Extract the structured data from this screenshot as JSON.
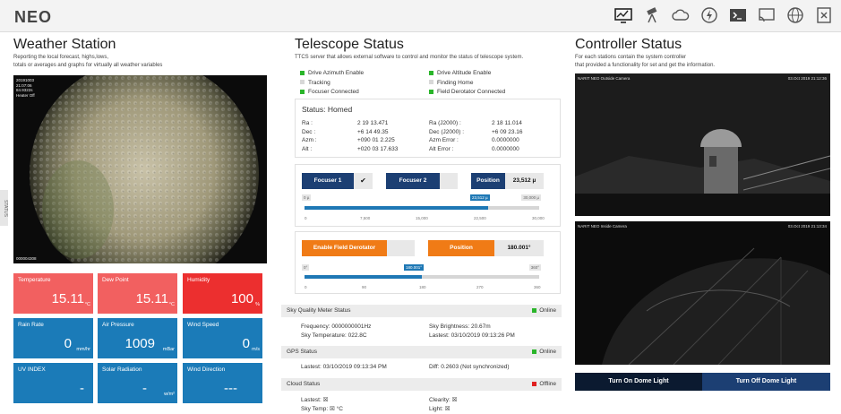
{
  "app": {
    "brand": "NEO",
    "top_icons": [
      "monitor-chart-icon",
      "telescope-icon",
      "cloud-icon",
      "lightning-icon",
      "terminal-icon",
      "cast-icon",
      "globe-icon",
      "exit-icon"
    ]
  },
  "weather": {
    "title": "Weather Station",
    "subtitle_line1": "Reporting the local forecast, highs,lows,",
    "subtitle_line2": "totals or averages and graphs for virtually all weather variables",
    "camera_overlay": [
      "20191003",
      "21:07:06",
      "84.9322s",
      "Heater Off"
    ],
    "camera_footer": "000004308",
    "status_tab": "STATUS",
    "tiles": [
      {
        "label": "Temperature",
        "value": "15.11",
        "unit": "°C",
        "color": "#f26060"
      },
      {
        "label": "Dew Point",
        "value": "15.11",
        "unit": "°C",
        "color": "#f26060"
      },
      {
        "label": "Humidity",
        "value": "100",
        "unit": "%",
        "color": "#ec2f2f"
      },
      {
        "label": "Rain Rate",
        "value": "0",
        "unit": "mm/hr",
        "color": "#1b7bb8"
      },
      {
        "label": "Air Pressure",
        "value": "1009",
        "unit": "mBar",
        "color": "#1b7bb8"
      },
      {
        "label": "Wind Speed",
        "value": "0",
        "unit": "m/s",
        "color": "#1b7bb8"
      },
      {
        "label": "UV INDEX",
        "value": "-",
        "unit": "",
        "color": "#1b7bb8"
      },
      {
        "label": "Solar Radiation",
        "value": "-",
        "unit": "w/m²",
        "color": "#1b7bb8"
      },
      {
        "label": "Wind Direction",
        "value": "---",
        "unit": "",
        "color": "#1b7bb8"
      }
    ]
  },
  "telescope": {
    "title": "Telescope Status",
    "subtitle": "TTCS server that allows external software to control and monitor the status of telescope system.",
    "checks_left": [
      {
        "label": "Drive Azimuth Enable",
        "on": true
      },
      {
        "label": "Tracking",
        "on": false
      },
      {
        "label": "Focuser Connected",
        "on": true
      }
    ],
    "checks_right": [
      {
        "label": "Drive Altitude Enable",
        "on": true
      },
      {
        "label": "Finding Home",
        "on": false
      },
      {
        "label": "Field Derotator Connected",
        "on": true
      }
    ],
    "status_label": "Status: Homed",
    "coords_left": [
      {
        "k": "Ra :",
        "v": "2 19 13.471"
      },
      {
        "k": "Dec :",
        "v": "+6 14 49.35"
      },
      {
        "k": "Azm :",
        "v": "+090 01 2.225"
      },
      {
        "k": "Alt :",
        "v": "+020 03 17.633"
      }
    ],
    "coords_right": [
      {
        "k": "Ra (J2000) :",
        "v": "2 18 11.014"
      },
      {
        "k": "Dec (J2000) :",
        "v": "+6 09 23.16"
      },
      {
        "k": "Azm Error :",
        "v": "0.0000000"
      },
      {
        "k": "Alt Error :",
        "v": "0.0000000"
      }
    ],
    "focuser": {
      "focuser1_label": "Focuser 1",
      "focuser1_check": "✔",
      "focuser2_label": "Focuser 2",
      "position_label": "Position",
      "position_value": "23,512 µ",
      "min_pill": "0 µ",
      "max_pill": "30,000 µ",
      "current_pill": "23,512 µ",
      "fraction": 0.7837,
      "ticks": [
        "0",
        "7,500",
        "15,000",
        "22,500",
        "30,000"
      ]
    },
    "derotator": {
      "enable_label": "Enable Field Derotator",
      "position_label": "Position",
      "position_value": "180.001°",
      "min_pill": "0°",
      "max_pill": "360°",
      "current_pill": "180.001°",
      "fraction": 0.5,
      "ticks": [
        "0",
        "90",
        "180",
        "270",
        "360"
      ]
    },
    "sqm": {
      "title": "Sky Quality Meter Status",
      "status": "Online",
      "status_color": "#2ab52a",
      "frequency": "Frequency:  0000000001Hz",
      "sky_temp": "Sky Temperature: 022.8C",
      "brightness": "Sky Brightness: 20.67m",
      "lastest": "Lastest: 03/10/2019 09:13:26 PM"
    },
    "gps": {
      "title": "GPS Status",
      "status": "Online",
      "status_color": "#2ab52a",
      "lastest": "Lastest: 03/10/2019 09:13:34 PM",
      "diff": "Diff: 0.2603 (Not synchronized)"
    },
    "cloud": {
      "title": "Cloud Status",
      "status": "Offline",
      "status_color": "#e02020",
      "lastest": "Lastest: ☒",
      "sky_temp": "Sky Temp: ☒ °C",
      "clearity": "Clearity: ☒",
      "light": "Light: ☒"
    }
  },
  "controller": {
    "title": "Controller Status",
    "subtitle_line1": "For each stations contain the system controller",
    "subtitle_line2": "that provided a functionality for set and get the information.",
    "cam_outside_label": "NARIT NEO Outside Camera",
    "cam_outside_time": "03.Oct 2019    21:12:36",
    "cam_inside_label": "NARIT NEO Inside Camera",
    "cam_inside_time": "03.Oct 2019    21:13:34",
    "dome_on": "Turn On Dome Light",
    "dome_off": "Turn Off Dome Light"
  }
}
